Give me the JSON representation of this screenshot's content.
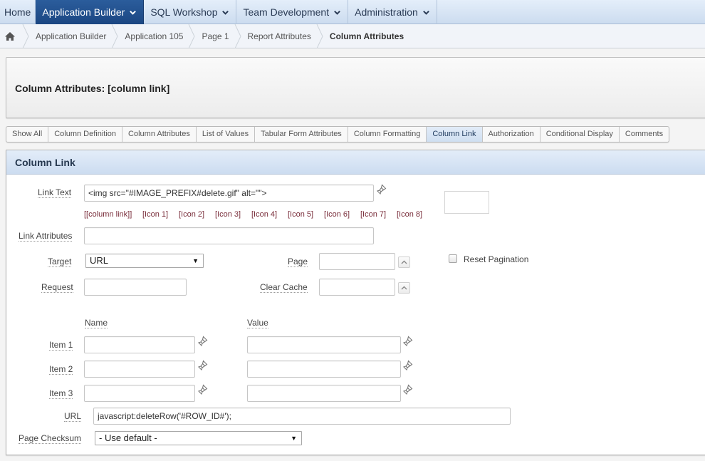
{
  "topnav": {
    "tabs": [
      {
        "label": "Home",
        "active": false,
        "dropdown": false
      },
      {
        "label": "Application Builder",
        "active": true,
        "dropdown": true
      },
      {
        "label": "SQL Workshop",
        "active": false,
        "dropdown": true
      },
      {
        "label": "Team Development",
        "active": false,
        "dropdown": true
      },
      {
        "label": "Administration",
        "active": false,
        "dropdown": true
      }
    ]
  },
  "breadcrumb": {
    "home_icon": "home-icon",
    "items": [
      {
        "label": "Application Builder"
      },
      {
        "label": "Application 105"
      },
      {
        "label": "Page 1"
      },
      {
        "label": "Report Attributes"
      },
      {
        "label": "Column Attributes",
        "current": true
      }
    ]
  },
  "page": {
    "title": "Column Attributes: [column link]"
  },
  "subtabs": {
    "active": "Column Link",
    "items": [
      "Show All",
      "Column Definition",
      "Column Attributes",
      "List of Values",
      "Tabular Form Attributes",
      "Column Formatting",
      "Column Link",
      "Authorization",
      "Conditional Display",
      "Comments"
    ]
  },
  "region": {
    "title": "Column Link",
    "link_text": {
      "label": "Link Text",
      "value": "<img src=\"#IMAGE_PREFIX#delete.gif\" alt=\"\">",
      "shortcuts": [
        "[[column link]]",
        "[Icon 1]",
        "[Icon 2]",
        "[Icon 3]",
        "[Icon 4]",
        "[Icon 5]",
        "[Icon 6]",
        "[Icon 7]",
        "[Icon 8]"
      ]
    },
    "link_attributes": {
      "label": "Link Attributes",
      "value": ""
    },
    "target": {
      "label": "Target",
      "value": "URL"
    },
    "page": {
      "label": "Page",
      "value": ""
    },
    "reset_pagination": {
      "label": "Reset Pagination",
      "checked": false
    },
    "request": {
      "label": "Request",
      "value": ""
    },
    "clear_cache": {
      "label": "Clear Cache",
      "value": ""
    },
    "items_header": {
      "name": "Name",
      "value": "Value"
    },
    "items": [
      {
        "label": "Item 1",
        "name": "",
        "value": ""
      },
      {
        "label": "Item 2",
        "name": "",
        "value": ""
      },
      {
        "label": "Item 3",
        "name": "",
        "value": ""
      }
    ],
    "url": {
      "label": "URL",
      "value": "javascript:deleteRow('#ROW_ID#');"
    },
    "page_checksum": {
      "label": "Page Checksum",
      "value": "- Use default -"
    }
  },
  "colors": {
    "nav_active": "#1f4c8a",
    "nav_bg": "#d7e4f4",
    "shortcut_link": "#7a2f3c",
    "region_header": "#d8e5f5"
  }
}
